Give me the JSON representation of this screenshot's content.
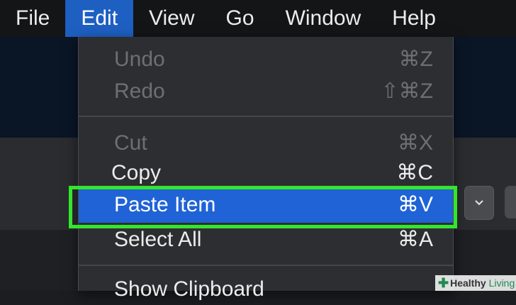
{
  "menubar": {
    "items": [
      {
        "label": "File"
      },
      {
        "label": "Edit"
      },
      {
        "label": "View"
      },
      {
        "label": "Go"
      },
      {
        "label": "Window"
      },
      {
        "label": "Help"
      }
    ],
    "active_index": 1
  },
  "edit_menu": {
    "items": [
      {
        "label": "Undo",
        "shortcut": "⌘Z",
        "enabled": false
      },
      {
        "label": "Redo",
        "shortcut": "⇧⌘Z",
        "enabled": false
      },
      {
        "label": "Cut",
        "shortcut": "⌘X",
        "enabled": false
      },
      {
        "label": "Copy",
        "shortcut": "⌘C",
        "enabled": true
      },
      {
        "label": "Paste Item",
        "shortcut": "⌘V",
        "enabled": true,
        "highlighted": true
      },
      {
        "label": "Select All",
        "shortcut": "⌘A",
        "enabled": true
      },
      {
        "label": "Show Clipboard",
        "shortcut": "",
        "enabled": true
      }
    ]
  },
  "watermark": {
    "text_1": "Healthy",
    "text_2": "Living"
  },
  "colors": {
    "highlight": "#1f63d6",
    "annotation": "#33e62d",
    "menubar_active": "#1e5fc2"
  }
}
